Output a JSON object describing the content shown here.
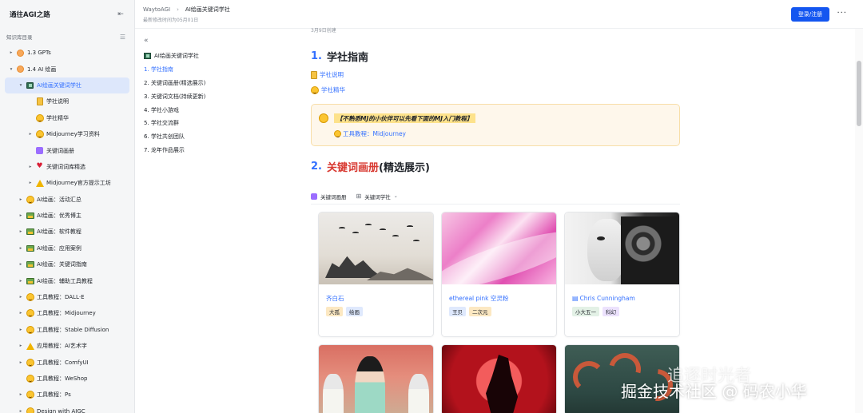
{
  "sidebar": {
    "title": "通往AGI之路",
    "subtitle": "知识库目录",
    "items": [
      {
        "label": "1.3 GPTs",
        "icon": "orange-circle-icon",
        "level": 1,
        "arrow": "▸"
      },
      {
        "label": "1.4 AI 绘画",
        "icon": "orange-circle-icon",
        "level": 1,
        "arrow": "▾"
      },
      {
        "label": "AI绘画关键词学社",
        "icon": "book-icon",
        "level": 2,
        "arrow": "▾",
        "active": true
      },
      {
        "label": "学社说明",
        "icon": "note-icon",
        "level": 3,
        "arrow": ""
      },
      {
        "label": "学社精华",
        "icon": "smiley-icon",
        "level": 3,
        "arrow": ""
      },
      {
        "label": "Midjourney学习资料",
        "icon": "smiley-icon",
        "level": 3,
        "arrow": "▸"
      },
      {
        "label": "关键词画册",
        "icon": "purple-square-icon",
        "level": 3,
        "arrow": ""
      },
      {
        "label": "关键词词库精选",
        "icon": "heart-icon",
        "level": 3,
        "arrow": "▸"
      },
      {
        "label": "Midjourney官方提示工坊",
        "icon": "warning-icon",
        "level": 3,
        "arrow": "▸"
      },
      {
        "label": "AI绘画：活动汇总",
        "icon": "smiley-icon",
        "level": 2,
        "arrow": "▸"
      },
      {
        "label": "AI绘画：优秀博主",
        "icon": "image-icon",
        "level": 2,
        "arrow": "▸"
      },
      {
        "label": "AI绘画：软件教程",
        "icon": "image-icon",
        "level": 2,
        "arrow": "▸"
      },
      {
        "label": "AI绘画：应用案例",
        "icon": "image-icon",
        "level": 2,
        "arrow": "▸"
      },
      {
        "label": "AI绘画：关键词指南",
        "icon": "image-icon",
        "level": 2,
        "arrow": "▸"
      },
      {
        "label": "AI绘画：辅助工具教程",
        "icon": "image-icon",
        "level": 2,
        "arrow": "▸"
      },
      {
        "label": "工具教程：DALL·E",
        "icon": "smiley-icon",
        "level": 2,
        "arrow": "▸"
      },
      {
        "label": "工具教程：Midjourney",
        "icon": "smiley-icon",
        "level": 2,
        "arrow": "▸"
      },
      {
        "label": "工具教程：Stable Diffusion",
        "icon": "smiley-icon",
        "level": 2,
        "arrow": "▸"
      },
      {
        "label": "应用教程：AI艺术字",
        "icon": "warning-icon",
        "level": 2,
        "arrow": "▸"
      },
      {
        "label": "工具教程：ComfyUI",
        "icon": "smiley-icon",
        "level": 2,
        "arrow": "▸"
      },
      {
        "label": "工具教程：WeShop",
        "icon": "smiley-icon",
        "level": 2,
        "arrow": ""
      },
      {
        "label": "工具教程：Ps",
        "icon": "smiley-icon",
        "level": 2,
        "arrow": "▸"
      },
      {
        "label": "Design with AIGC",
        "icon": "smiley-icon",
        "level": 2,
        "arrow": "▸"
      }
    ]
  },
  "header": {
    "breadcrumb_root": "WaytoAGI",
    "breadcrumb_sep": "›",
    "breadcrumb_current": "AI绘画关键词学社",
    "edited": "最新修改时间为05月01日",
    "login_label": "登录/注册",
    "more_label": "···"
  },
  "toc": {
    "toggle": "«",
    "title": "AI绘画关键词学社",
    "items": [
      {
        "label": "1. 学社指南",
        "active": true
      },
      {
        "label": "2. 关键词画册(精选展示)"
      },
      {
        "label": "3. 关键词文档(持续更新)"
      },
      {
        "label": "4. 学社小游戏"
      },
      {
        "label": "5. 学社交流群"
      },
      {
        "label": "6. 学社共创团队"
      },
      {
        "label": "7. 龙年作品展示"
      }
    ]
  },
  "doc": {
    "dated": "3月9日创建",
    "h1_num": "1.",
    "h1_text": "学社指南",
    "link1": "学社说明",
    "link2": "学社精华",
    "callout_text": "【不熟悉MJ的小伙伴可以先看下面的MJ入门教程】",
    "callout_link": "工具教程：Midjourney",
    "h2_num": "2.",
    "h2_red": "关键词画册",
    "h2_plain": "(精选展示)",
    "view1": "关键词画册",
    "view2": "关键词学社"
  },
  "gallery": {
    "cards": [
      {
        "title": "齐白石",
        "tags": [
          "大孤",
          "绘画"
        ],
        "image": "ink-landscape"
      },
      {
        "title": "ethereal pink 空灵粉",
        "tags": [
          "王贝",
          "二次元"
        ],
        "image": "pink-abstract"
      },
      {
        "title": "Chris Cunningham",
        "tags": [
          "小大五一",
          "科幻"
        ],
        "image": "robot-face",
        "doc_icon": true
      },
      {
        "title": "",
        "tags": [],
        "image": "retro-fashion"
      },
      {
        "title": "",
        "tags": [],
        "image": "red-moon-figure"
      },
      {
        "title": "",
        "tags": [],
        "image": "octopus"
      }
    ]
  },
  "watermark": {
    "line1": "追逐时光者",
    "line2": "掘金技术社区 @ 码农小华"
  },
  "colors": {
    "accent": "#3370ff",
    "login_button": "#1456f0",
    "heading_red": "#d83931",
    "callout_bg": "#fef7eb"
  }
}
